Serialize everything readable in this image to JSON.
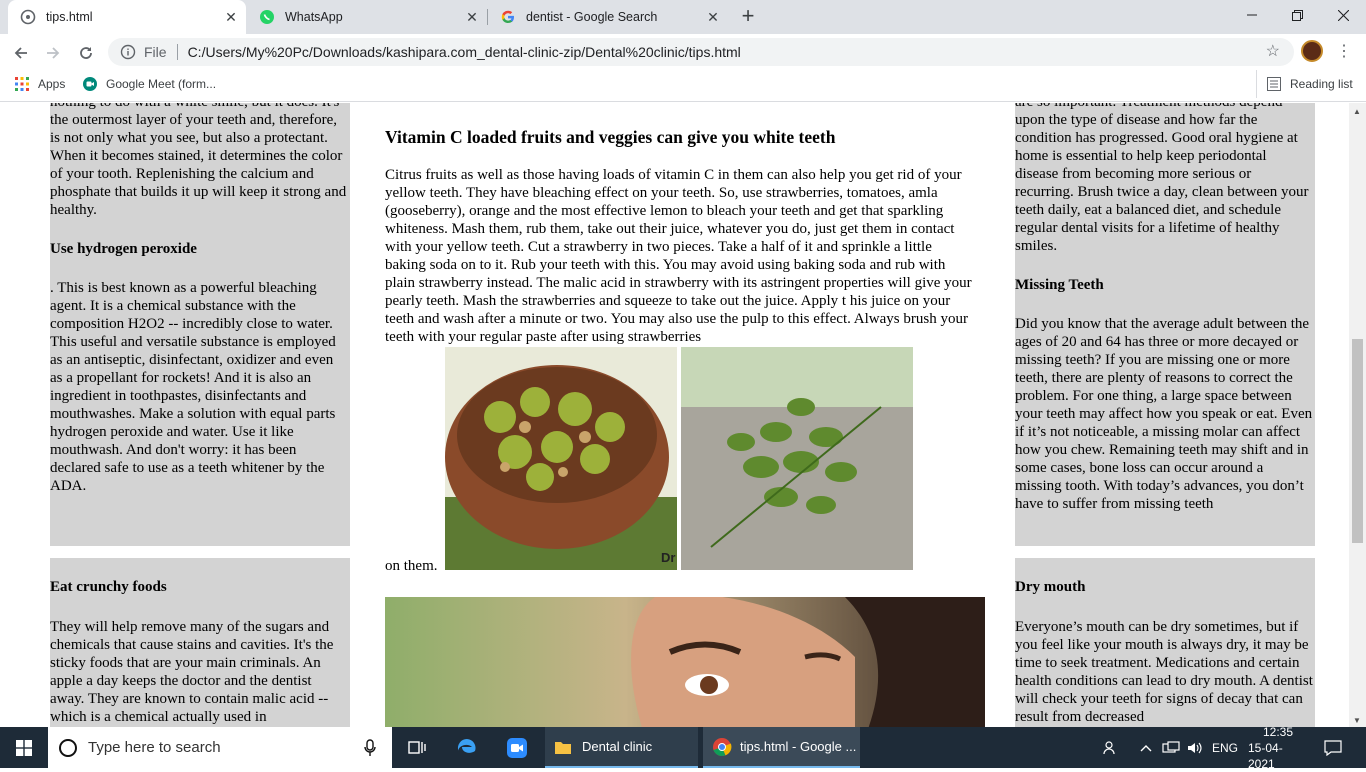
{
  "browser": {
    "tabs": [
      {
        "title": "tips.html",
        "icon": "globe-icon",
        "active": true
      },
      {
        "title": "WhatsApp",
        "icon": "whatsapp-icon",
        "active": false
      },
      {
        "title": "dentist - Google Search",
        "icon": "google-icon",
        "active": false
      }
    ],
    "url_prefix": "File",
    "url": "C:/Users/My%20Pc/Downloads/kashipara.com_dental-clinic-zip/Dental%20clinic/tips.html",
    "bookmarks": {
      "apps": "Apps",
      "meet": "Google Meet (form...",
      "reading_list": "Reading list"
    }
  },
  "left_column": {
    "top_partial": "nothing to do with a white smile, but it does. It's the outermost layer of your teeth and, therefore, is not only what you see, but also a protectant. When it becomes stained, it determines the color of your tooth. Replenishing the calcium and phosphate that builds it up will keep it strong and healthy.",
    "heading1": "Use hydrogen peroxide",
    "body1": ". This is best known as a powerful bleaching agent. It is a chemical substance with the composition H2O2 -- incredibly close to water. This useful and versatile substance is employed as an antiseptic, disinfectant, oxidizer and even as a propellant for rockets! And it is also an ingredient in toothpastes, disinfectants and mouthwashes. Make a solution with equal parts hydrogen peroxide and water. Use it like mouthwash. And don't worry: it has been declared safe to use as a teeth whitener by the ADA.",
    "heading2": "Eat crunchy foods",
    "body2": "They will help remove many of the sugars and chemicals that cause stains and cavities. It's the sticky foods that are your main criminals. An apple a day keeps the doctor and the dentist away. They are known to contain malic acid -- which is a chemical actually used in"
  },
  "center_column": {
    "heading": "Vitamin C loaded fruits and veggies can give you white teeth",
    "body": "Citrus fruits as well as those having loads of vitamin C in them can also help you get rid of your yellow teeth. They have bleaching effect on your teeth. So, use strawberries, tomatoes, amla (gooseberry), orange and the most effective lemon to bleach your teeth and get that sparkling whiteness. Mash them, rub them, take out their juice, whatever you do, just get them in contact with your yellow teeth. Cut a strawberry in two pieces. Take a half of it and sprinkle a little baking soda on to it. Rub your teeth with this. You may avoid using baking soda and rub with plain strawberry instead. The malic acid in strawberry with its astringent properties will give your pearly teeth. Mash the strawberries and squeeze to take out the juice. Apply t his juice on your teeth and wash after a minute or two. You may also use the pulp to this effect. Always brush your teeth with your regular paste after using strawberries",
    "tail": "on them."
  },
  "right_column": {
    "top_partial": "are so important. Treatment methods depend upon the type of disease and how far the condition has progressed. Good oral hygiene at home is essential to help keep periodontal disease from becoming more serious or recurring. Brush twice a day, clean between your teeth daily, eat a balanced diet, and schedule regular dental visits for a lifetime of healthy smiles.",
    "heading1": "Missing Teeth",
    "body1": "Did you know that the average adult between the ages of 20 and 64 has three or more decayed or missing teeth? If you are missing one or more teeth, there are plenty of reasons to correct the problem. For one thing, a large space between your teeth may affect how you speak or eat. Even if it’s not noticeable, a missing molar can affect how you chew. Remaining teeth may shift and in some cases, bone loss can occur around a missing tooth. With today’s advances, you don’t have to suffer from missing teeth",
    "heading2": "Dry mouth",
    "body2": "Everyone’s mouth can be dry sometimes, but if you feel like your mouth is always dry, it may be time to seek treatment. Medications and certain health conditions can lead to dry mouth. A dentist will check your teeth for signs of decay that can result from decreased"
  },
  "taskbar": {
    "search_placeholder": "Type here to search",
    "apps": [
      {
        "label": "Dental clinic",
        "icon": "folder-icon"
      },
      {
        "label": "tips.html - Google ...",
        "icon": "chrome-icon"
      }
    ],
    "lang": "ENG",
    "time": "12:35",
    "date": "15-04-2021"
  }
}
